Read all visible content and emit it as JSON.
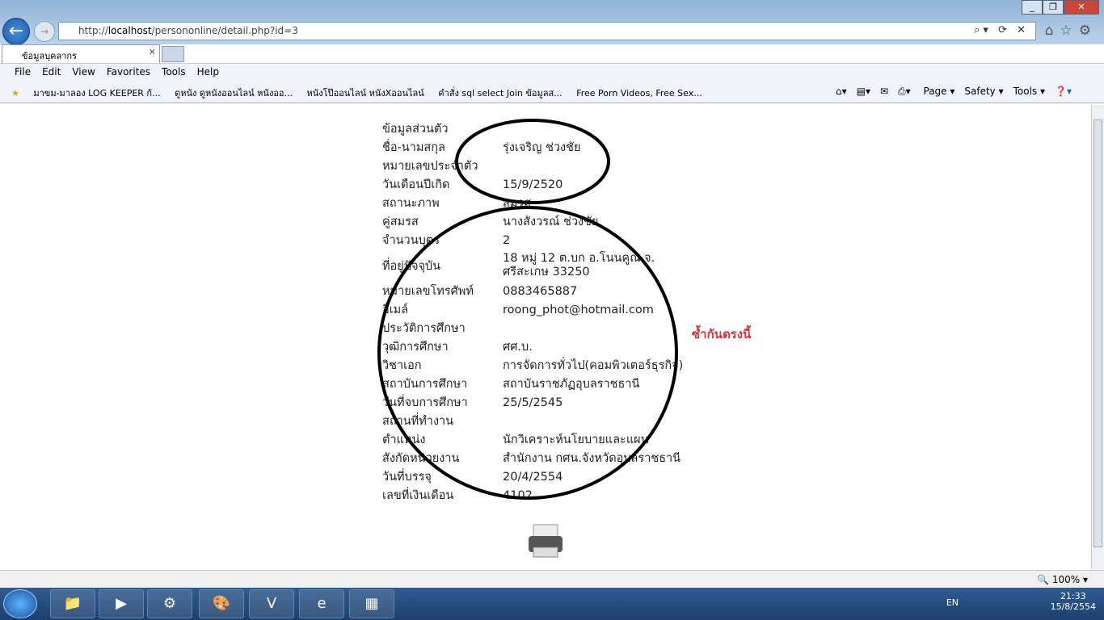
{
  "browser": {
    "url_prefix": "http://",
    "url_host": "localhost",
    "url_path": "/persononline/detail.php?id=3",
    "tab_title": "ข้อมูลบุคลากร",
    "menu": [
      "File",
      "Edit",
      "View",
      "Favorites",
      "Tools",
      "Help"
    ],
    "favorites": [
      "มาขม-มาลอง LOG KEEPER ก้...",
      "ดูหนัง ดูหนังออนไลน์ หนังออ...",
      "หนังโป๊ออนไลน์ หนังXออนไลน์",
      "คำสั่ง sql select Join ข้อมูลส...",
      "Free Porn Videos, Free Sex..."
    ],
    "commands": [
      "Page ▾",
      "Safety ▾",
      "Tools ▾"
    ],
    "zoom": "100%"
  },
  "record": [
    {
      "label": "ข้อมูลส่วนตัว",
      "value": ""
    },
    {
      "label": "ชื่อ-นามสกุล",
      "value": "รุ่งเจริญ  ช่วงชัย"
    },
    {
      "label": "หมายเลขประจำตัว",
      "value": ""
    },
    {
      "label": "วันเดือนปีเกิด",
      "value": "15/9/2520"
    },
    {
      "label": "สถานะภาพ",
      "value": "สมรส"
    },
    {
      "label": "คู่สมรส",
      "value": "นางสังวรณ์ ช่วงชัย"
    },
    {
      "label": "จำนวนบุตร",
      "value": "2"
    },
    {
      "label": "ที่อยู่ปัจจุบัน",
      "value": "18 หมู่ 12 ต.บก อ.โนนคูณ จ.",
      "value2": "ศรีสะเกษ 33250"
    },
    {
      "label": "หมายเลขโทรศัพท์",
      "value": "0883465887"
    },
    {
      "label": "อีเมล์",
      "value": "roong_phot@hotmail.com"
    },
    {
      "label": "ประวัติการศึกษา",
      "value": ""
    },
    {
      "label": "วุฒิการศึกษา",
      "value": "ศศ.บ."
    },
    {
      "label": "วิชาเอก",
      "value": "การจัดการทั่วไป(คอมพิวเตอร์ธุรกิจ)"
    },
    {
      "label": "สถาบันการศึกษา",
      "value": "สถาบันราชภัฏอุบลราชธานี"
    },
    {
      "label": "วันที่จบการศึกษา",
      "value": "25/5/2545"
    },
    {
      "label": "สถานที่ทำงาน",
      "value": ""
    },
    {
      "label": "ตำแหน่ง",
      "value": "นักวิเคราะห์นโยบายและแผน"
    },
    {
      "label": "สังกัดหน่วยงาน",
      "value": "สำนักงาน กศน.จังหวัดอุบลราชธานี"
    },
    {
      "label": "วันที่บรรจุ",
      "value": "20/4/2554"
    },
    {
      "label": "เลขที่เงินเดือน",
      "value": "4102"
    }
  ],
  "annotation": "ซ้ำกันตรงนี้",
  "taskbar": {
    "lang": "EN",
    "time": "21:33",
    "date": "15/8/2554"
  }
}
